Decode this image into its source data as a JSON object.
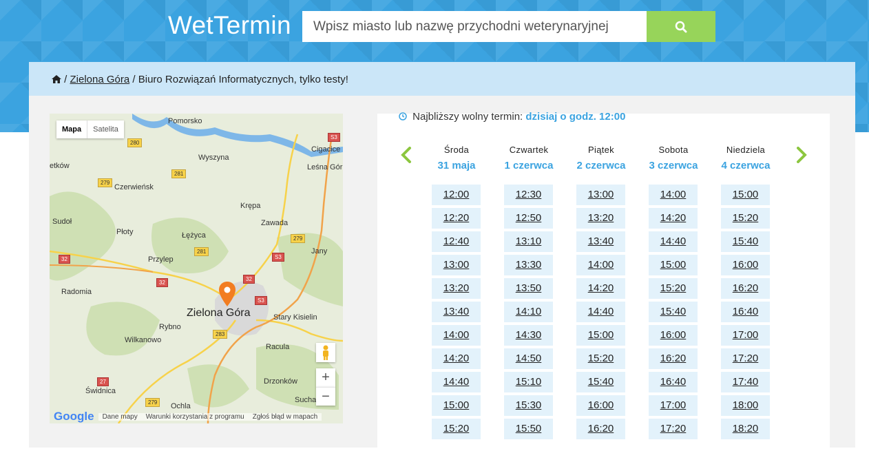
{
  "header": {
    "brand": "WetTermin",
    "search_placeholder": "Wpisz miasto lub nazwę przychodni weterynaryjnej",
    "accent_color": "#3ba3e0",
    "button_color": "#97d45a",
    "search_button_icon": "search-icon"
  },
  "breadcrumb": {
    "home_icon": "home-icon",
    "separator": "/",
    "city": "Zielona Góra",
    "current": "Biuro Rozwiązań Informatycznych, tylko testy!"
  },
  "map": {
    "tabs": [
      "Mapa",
      "Satelita"
    ],
    "labels": [
      "Pomorsko",
      "Cigacice",
      "Leśna Gór",
      "etków",
      "Wyszyna",
      "Czerwieńsk",
      "Krępa",
      "Sudoł",
      "Zawada",
      "Płoty",
      "Łężyca",
      "Jany",
      "Przylep",
      "Radomia",
      "Zielona Góra",
      "Stary Kisielin",
      "Rybno",
      "Wilkanowo",
      "Racula",
      "Drzonków",
      "Świdnica",
      "Ochla",
      "Sucha"
    ],
    "road_badges": [
      "280",
      "S3",
      "281",
      "279",
      "279",
      "281",
      "S3",
      "32",
      "32",
      "32",
      "S3",
      "283",
      "27",
      "279"
    ],
    "footer": [
      "Google",
      "Dane mapy",
      "Warunki korzystania z programu",
      "Zgłoś błąd w mapach"
    ],
    "zoom_in": "+",
    "zoom_out": "−",
    "pegman_icon": "pegman-icon",
    "marker_icon": "map-marker-icon"
  },
  "calendar": {
    "nearest_label": "Najbliższy wolny termin:",
    "nearest_value": "dzisiaj o godz. 12:00",
    "prev_icon": "chevron-left-icon",
    "next_icon": "chevron-right-icon",
    "days": [
      {
        "name": "Środa",
        "date": "31 maja",
        "slots": [
          "12:00",
          "12:20",
          "12:40",
          "13:00",
          "13:20",
          "13:40",
          "14:00",
          "14:20",
          "14:40",
          "15:00",
          "15:20"
        ]
      },
      {
        "name": "Czwartek",
        "date": "1 czerwca",
        "slots": [
          "12:30",
          "12:50",
          "13:10",
          "13:30",
          "13:50",
          "14:10",
          "14:30",
          "14:50",
          "15:10",
          "15:30",
          "15:50"
        ]
      },
      {
        "name": "Piątek",
        "date": "2 czerwca",
        "slots": [
          "13:00",
          "13:20",
          "13:40",
          "14:00",
          "14:20",
          "14:40",
          "15:00",
          "15:20",
          "15:40",
          "16:00",
          "16:20"
        ]
      },
      {
        "name": "Sobota",
        "date": "3 czerwca",
        "slots": [
          "14:00",
          "14:20",
          "14:40",
          "15:00",
          "15:20",
          "15:40",
          "16:00",
          "16:20",
          "16:40",
          "17:00",
          "17:20"
        ]
      },
      {
        "name": "Niedziela",
        "date": "4 czerwca",
        "slots": [
          "15:00",
          "15:20",
          "15:40",
          "16:00",
          "16:20",
          "16:40",
          "17:00",
          "17:20",
          "17:40",
          "18:00",
          "18:20"
        ]
      }
    ]
  }
}
